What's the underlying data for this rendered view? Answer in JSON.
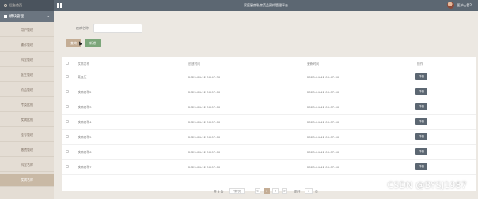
{
  "header": {
    "home_label": "后台首页",
    "title": "家庭厨房私房菜品预约管理平台",
    "user_name": "医护士管2"
  },
  "sidebar": {
    "module_label": "模块管理",
    "items": [
      {
        "label": "用户管理"
      },
      {
        "label": "辅诊管理"
      },
      {
        "label": "科室管理"
      },
      {
        "label": "医生管理"
      },
      {
        "label": "药品管理"
      },
      {
        "label": "传染比例"
      },
      {
        "label": "疾病比例"
      },
      {
        "label": "挂号管理"
      },
      {
        "label": "缴费管理"
      },
      {
        "label": "科室名称"
      },
      {
        "label": "疾病名称"
      }
    ]
  },
  "search": {
    "label": "疾病名称",
    "value": "",
    "search_button": "查询",
    "add_button": "新增"
  },
  "table": {
    "columns": [
      "疾病名称",
      "创建时间",
      "更新时间",
      "操作"
    ],
    "rows": [
      {
        "name": "莫血压",
        "created": "2023-04-12 00:47:30",
        "updated": "2023-04-12 00:47:30",
        "action": "详情"
      },
      {
        "name": "疾病名称2",
        "created": "2023-04-12 00:07:00",
        "updated": "2023-04-12 00:07:00",
        "action": "详情"
      },
      {
        "name": "疾病名称3",
        "created": "2023-04-12 00:07:00",
        "updated": "2023-04-12 00:07:00",
        "action": "详情"
      },
      {
        "name": "疾病名称4",
        "created": "2023-04-12 00:07:00",
        "updated": "2023-04-12 00:07:00",
        "action": "详情"
      },
      {
        "name": "疾病名称5",
        "created": "2023-04-12 00:07:00",
        "updated": "2023-04-12 00:07:00",
        "action": "详情"
      },
      {
        "name": "疾病名称6",
        "created": "2023-04-12 00:07:00",
        "updated": "2023-04-12 00:07:00",
        "action": "详情"
      },
      {
        "name": "疾病名称7",
        "created": "2023-04-12 00:07:00",
        "updated": "2023-04-12 00:07:00",
        "action": "详情"
      }
    ]
  },
  "pagination": {
    "total": "共 9 条",
    "page_size": "7条/页",
    "prev": "<",
    "pages": [
      "1",
      "2"
    ],
    "next": ">",
    "goto_label": "前往",
    "goto_value": "1",
    "page_unit": "页"
  },
  "watermark": "CSDN @BYSJ1987"
}
